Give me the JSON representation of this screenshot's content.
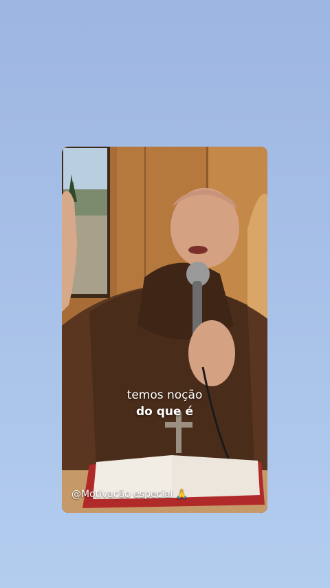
{
  "video": {
    "caption_line1": "temos noção",
    "caption_line2": "do que é",
    "watermark": "@Motivação especial"
  },
  "colors": {
    "background_top": "#9db6e2",
    "background_bottom": "#b3cdef",
    "robe": "#4a2c1a",
    "wall": "#b0743b"
  },
  "icons": {
    "watermark_emoji": "praying-hands-icon"
  }
}
